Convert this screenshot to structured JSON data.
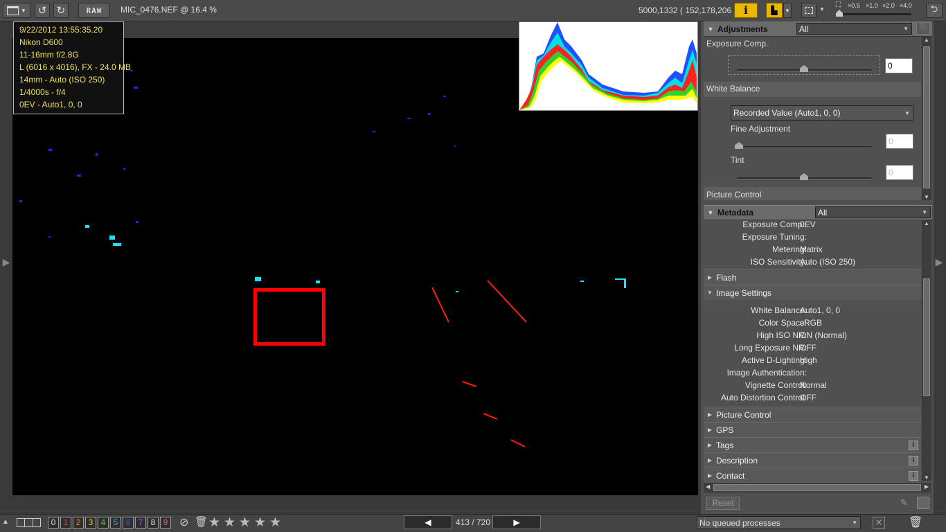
{
  "toolbar": {
    "raw_label": "RAW",
    "filename": "MIC_0476.NEF @ 16.4 %",
    "coords": "5000,1332 ( 152,178,206 )",
    "zoom_labels": [
      "×0.5",
      "×1.0",
      "×2.0",
      "×4.0"
    ]
  },
  "info": [
    "9/22/2012 13:55:35.20",
    "Nikon D600",
    "11-16mm f/2.8G",
    "L (6016 x 4016), FX - 24.0 MB",
    "14mm - Auto (ISO 250)",
    "1/4000s - f/4",
    "0EV - Auto1, 0, 0"
  ],
  "adjustments": {
    "title": "Adjustments",
    "filter": "All",
    "exposure_label": "Exposure Comp.",
    "exposure_value": "0",
    "white_balance_label": "White Balance",
    "wb_select": "Recorded Value (Auto1, 0, 0)",
    "fine_label": "Fine Adjustment",
    "fine_value": "0",
    "tint_label": "Tint",
    "tint_value": "0",
    "picture_control_label": "Picture Control"
  },
  "metadata": {
    "title": "Metadata",
    "filter": "All",
    "top_rows": [
      {
        "k": "Exposure Comp.:",
        "v": "0EV"
      },
      {
        "k": "Exposure Tuning:",
        "v": ""
      },
      {
        "k": "Metering:",
        "v": "Matrix"
      },
      {
        "k": "ISO Sensitivity:",
        "v": "Auto (ISO 250)"
      }
    ],
    "flash": "Flash",
    "image_settings": "Image Settings",
    "image_rows": [
      {
        "k": "White Balance:",
        "v": "Auto1, 0, 0"
      },
      {
        "k": "Color Space:",
        "v": "sRGB"
      },
      {
        "k": "High ISO NR:",
        "v": "ON (Normal)"
      },
      {
        "k": "Long Exposure NR:",
        "v": "OFF"
      },
      {
        "k": "Active D-Lighting:",
        "v": "High"
      },
      {
        "k": "Image Authentication:",
        "v": ""
      },
      {
        "k": "Vignette Control:",
        "v": "Normal"
      },
      {
        "k": "Auto Distortion Control:",
        "v": "OFF"
      }
    ],
    "sections": [
      "Picture Control",
      "GPS",
      "Tags",
      "Description",
      "Contact"
    ]
  },
  "reset_label": "Reset",
  "bottom": {
    "labels": [
      "0",
      "1",
      "2",
      "3",
      "4",
      "5",
      "6",
      "7",
      "8",
      "9"
    ],
    "label_colors": [
      "#dddddd",
      "#e04040",
      "#e08030",
      "#e0d040",
      "#60c040",
      "#40a0e0",
      "#4060e0",
      "#a060e0",
      "#e0e0e0",
      "#d060a0"
    ],
    "page": "413 / 720",
    "queue": "No queued processes"
  }
}
